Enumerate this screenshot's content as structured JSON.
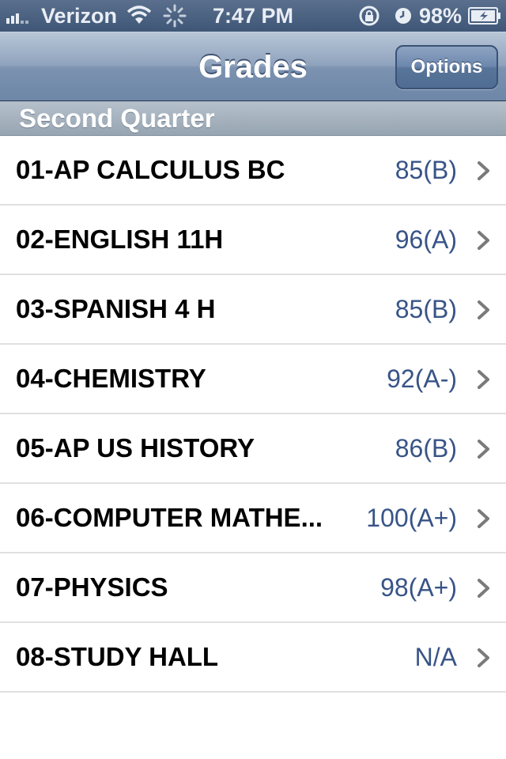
{
  "status_bar": {
    "carrier": "Verizon",
    "time": "7:47 PM",
    "battery_percent": "98%",
    "icons": [
      "signal-icon",
      "wifi-icon",
      "activity-spinner-icon",
      "rotation-lock-icon",
      "alarm-icon",
      "battery-icon"
    ]
  },
  "nav_bar": {
    "title": "Grades",
    "options_label": "Options"
  },
  "section": {
    "title": "Second Quarter"
  },
  "courses": [
    {
      "name": "01-AP CALCULUS BC",
      "grade": "85(B)"
    },
    {
      "name": "02-ENGLISH 11H",
      "grade": "96(A)"
    },
    {
      "name": "03-SPANISH 4 H",
      "grade": "85(B)"
    },
    {
      "name": "04-CHEMISTRY",
      "grade": "92(A-)"
    },
    {
      "name": "05-AP US HISTORY",
      "grade": "86(B)"
    },
    {
      "name": "06-COMPUTER MATHE...",
      "grade": "100(A+)"
    },
    {
      "name": "07-PHYSICS",
      "grade": "98(A+)"
    },
    {
      "name": "08-STUDY HALL",
      "grade": "N/A"
    }
  ],
  "colors": {
    "nav_gradient_top": "#b8c6d7",
    "nav_gradient_bottom": "#6d87a8",
    "grade_text": "#385487",
    "chevron": "#7a7a7a"
  }
}
